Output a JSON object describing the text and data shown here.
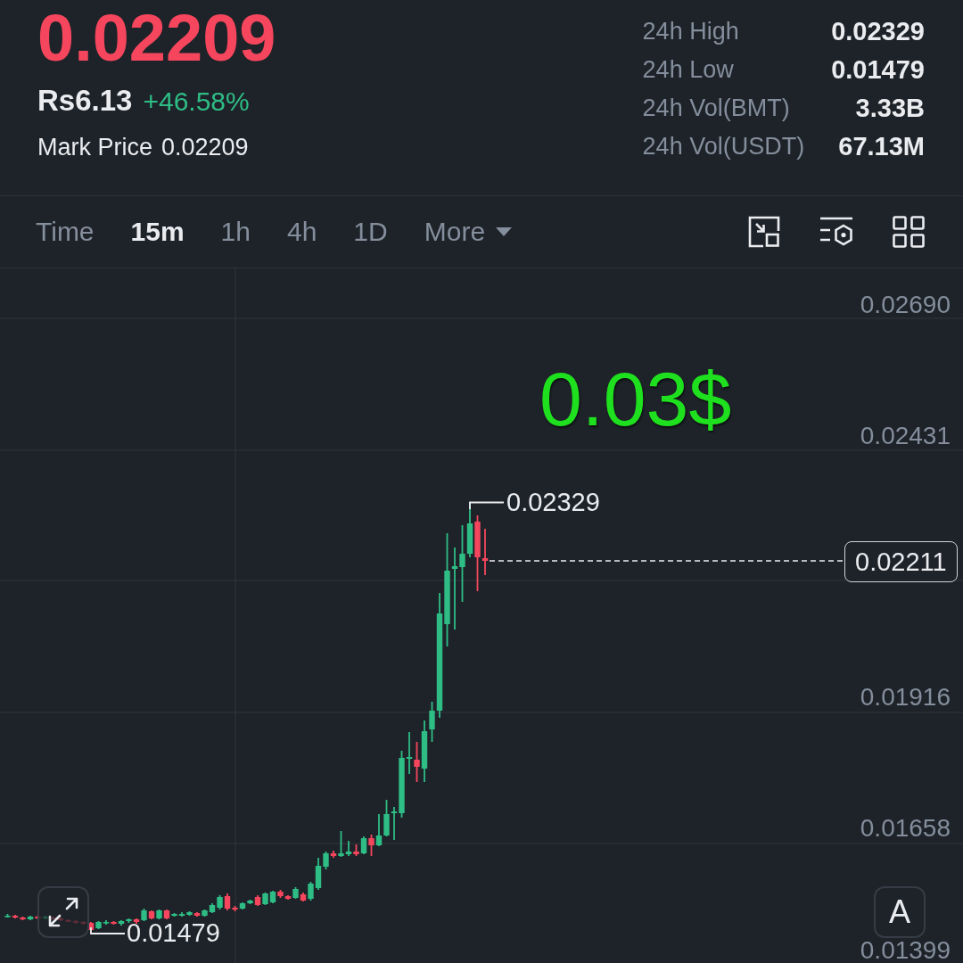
{
  "ticker": {
    "last_price": "0.02209",
    "price_falling": true,
    "fiat_price": "Rs6.13",
    "change": "+46.58%",
    "change_positive": true,
    "mark_price_label": "Mark Price",
    "mark_price": "0.02209"
  },
  "stats": [
    {
      "label": "24h High",
      "value": "0.02329"
    },
    {
      "label": "24h Low",
      "value": "0.01479"
    },
    {
      "label": "24h Vol(BMT)",
      "value": "3.33B"
    },
    {
      "label": "24h Vol(USDT)",
      "value": "67.13M"
    }
  ],
  "intervals": [
    {
      "label": "Time",
      "kind": "option",
      "selected": false
    },
    {
      "label": "15m",
      "kind": "option",
      "selected": true
    },
    {
      "label": "1h",
      "kind": "option",
      "selected": false
    },
    {
      "label": "4h",
      "kind": "option",
      "selected": false
    },
    {
      "label": "1D",
      "kind": "option",
      "selected": false
    },
    {
      "label": "More",
      "kind": "dropdown",
      "selected": false
    }
  ],
  "chart": {
    "price_axis": [
      "0.02690",
      "0.02431",
      "0.01916",
      "0.01658",
      "0.01399"
    ],
    "high_marker": "0.02329",
    "low_marker": "0.01479",
    "last_price_tag": "0.02211",
    "annotation": "0.03$",
    "scale_button": "A"
  }
}
